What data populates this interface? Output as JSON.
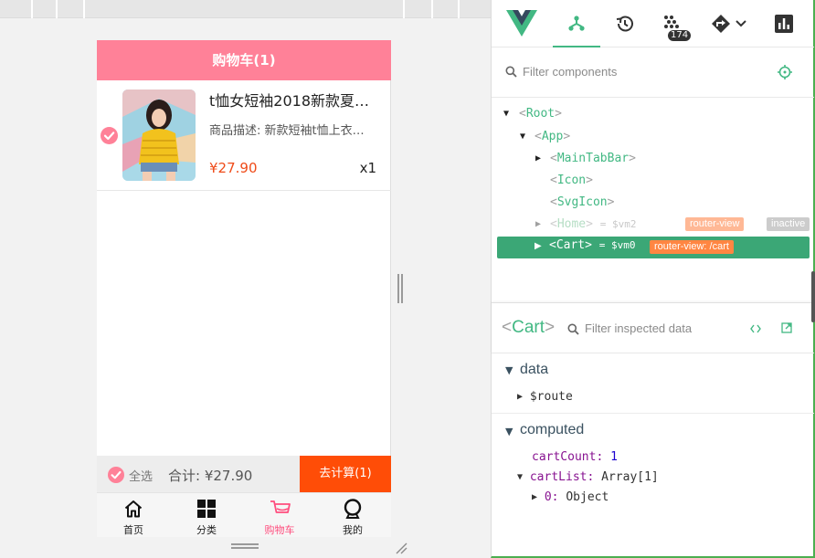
{
  "phone": {
    "nav_title": "购物车(1)",
    "item": {
      "title": "t恤女短袖2018新款夏…",
      "desc": "商品描述: 新款短袖t恤上衣…",
      "price": "¥27.90",
      "count": "x1"
    },
    "bottom": {
      "select_all": "全选",
      "total": "合计: ¥27.90",
      "checkout": "去计算(1)"
    },
    "tabs": [
      {
        "label": "首页",
        "icon": "home-icon"
      },
      {
        "label": "分类",
        "icon": "category-icon"
      },
      {
        "label": "购物车",
        "icon": "cart-icon"
      },
      {
        "label": "我的",
        "icon": "profile-icon"
      }
    ],
    "active_tab": "购物车"
  },
  "devtools": {
    "toolbar": {
      "event_badge": "174"
    },
    "filter_placeholder": "Filter components",
    "tree": [
      {
        "name": "Root"
      },
      {
        "name": "App"
      },
      {
        "name": "MainTabBar"
      },
      {
        "name": "Icon"
      },
      {
        "name": "SvgIcon"
      },
      {
        "name": "Home",
        "var": "= $vm2",
        "tags": [
          "router-view",
          "inactive"
        ]
      },
      {
        "name": "Cart",
        "var": "= $vm0",
        "tags": [
          "router-view: /cart"
        ]
      }
    ],
    "inspected": {
      "name": "Cart",
      "filter_placeholder": "Filter inspected data",
      "sections": {
        "data": {
          "title": "data",
          "route_key": "$route"
        },
        "computed": {
          "title": "computed",
          "cart_count_key": "cartCount:",
          "cart_count_value": "1",
          "cart_list_key": "cartList:",
          "cart_list_value": "Array[1]",
          "item0_key": "0:",
          "item0_value": "Object"
        }
      }
    }
  },
  "colors": {
    "nav_pink": "#ff8198",
    "checkout_orange": "#ff4d07",
    "price_red": "#ef4b19",
    "vue_green": "#42b883",
    "selected_row": "#3ba776",
    "router_view_pill": "#ffb895",
    "inactive_pill": "#cccccc",
    "selected_pill": "#ff8642"
  }
}
